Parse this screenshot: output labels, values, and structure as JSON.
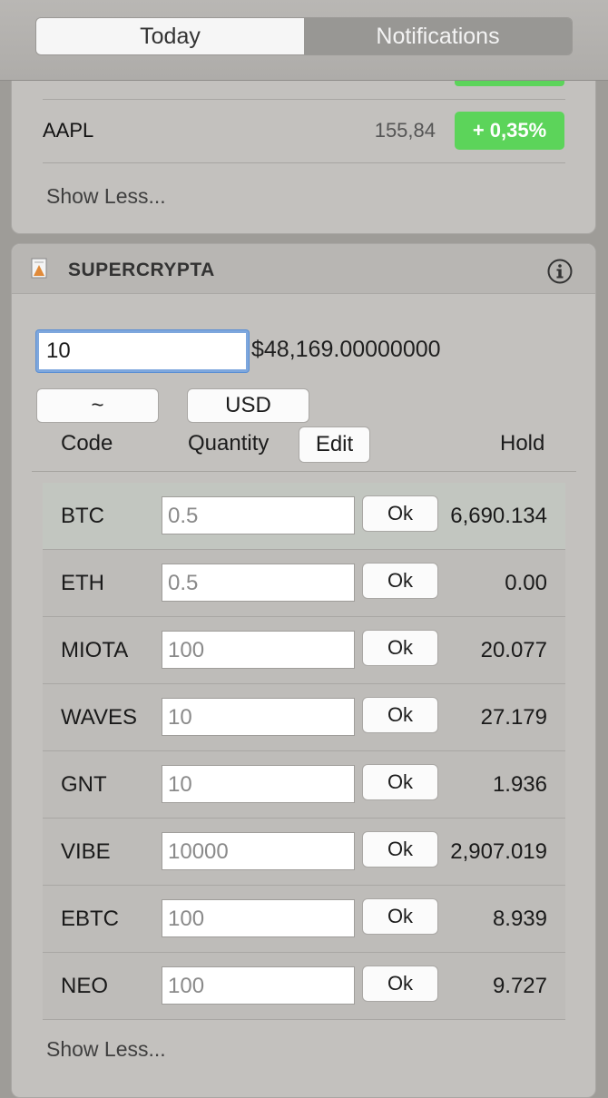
{
  "tabs": [
    {
      "label": "Today",
      "active": true
    },
    {
      "label": "Notifications",
      "active": false
    }
  ],
  "stocks": {
    "row": {
      "symbol": "AAPL",
      "price": "155,84",
      "change": "+ 0,35%"
    },
    "show_less": "Show Less..."
  },
  "crypto": {
    "title": "SUPERCRYPTA",
    "amount_input": "10",
    "total": "$48,169.00000000",
    "code_button": "~",
    "currency_button": "USD",
    "columns": {
      "code": "Code",
      "quantity": "Quantity",
      "edit": "Edit",
      "hold": "Hold"
    },
    "ok_label": "Ok",
    "rows": [
      {
        "code": "BTC",
        "qty": "0.5",
        "hold": "6,690.134"
      },
      {
        "code": "ETH",
        "qty": "0.5",
        "hold": "0.00"
      },
      {
        "code": "MIOTA",
        "qty": "100",
        "hold": "20.077"
      },
      {
        "code": "WAVES",
        "qty": "10",
        "hold": "27.179"
      },
      {
        "code": "GNT",
        "qty": "10",
        "hold": "1.936"
      },
      {
        "code": "VIBE",
        "qty": "10000",
        "hold": "2,907.019"
      },
      {
        "code": "EBTC",
        "qty": "100",
        "hold": "8.939"
      },
      {
        "code": "NEO",
        "qty": "100",
        "hold": "9.727"
      }
    ],
    "show_less": "Show Less..."
  },
  "colors": {
    "positive": "#5cd45a",
    "focus": "#7ea7dd"
  }
}
